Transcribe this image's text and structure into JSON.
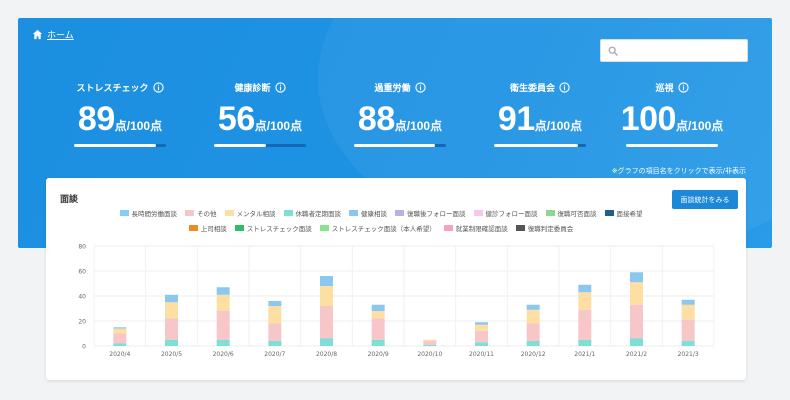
{
  "breadcrumb": {
    "home": "ホーム"
  },
  "search": {
    "placeholder": ""
  },
  "kpis": [
    {
      "label": "ストレスチェック",
      "value": "89",
      "unit": "点/100点",
      "progress": 0.89
    },
    {
      "label": "健康診断",
      "value": "56",
      "unit": "点/100点",
      "progress": 0.56
    },
    {
      "label": "過重労働",
      "value": "88",
      "unit": "点/100点",
      "progress": 0.88
    },
    {
      "label": "衛生委員会",
      "value": "91",
      "unit": "点/100点",
      "progress": 0.91
    },
    {
      "label": "巡視",
      "value": "100",
      "unit": "点/100点",
      "progress": 1.0
    }
  ],
  "note": "※グラフの項目名をクリックで表示/非表示",
  "card": {
    "title": "面談",
    "button": "面談統計をみる"
  },
  "chart_data": {
    "type": "bar",
    "stacked": true,
    "categories": [
      "2020/4",
      "2020/5",
      "2020/6",
      "2020/7",
      "2020/8",
      "2020/9",
      "2020/10",
      "2020/11",
      "2020/12",
      "2021/1",
      "2021/2",
      "2021/3"
    ],
    "ylim": [
      0,
      80
    ],
    "yticks": [
      0,
      20,
      40,
      60,
      80
    ],
    "grid": true,
    "legend_position": "top",
    "series": [
      {
        "name": "就業制限確認面談",
        "color": "#f4a3bd",
        "values": [
          0,
          0,
          0,
          0,
          0,
          0,
          0,
          0,
          0,
          0,
          0,
          0
        ]
      },
      {
        "name": "面接希望",
        "color": "#1f5f8b",
        "values": [
          0,
          0,
          0,
          0,
          0,
          0,
          0,
          0,
          0,
          0,
          0,
          0
        ]
      },
      {
        "name": "上司相談",
        "color": "#f08a24",
        "values": [
          0,
          0,
          0,
          0,
          0,
          0,
          0,
          0,
          0,
          0,
          0,
          0
        ]
      },
      {
        "name": "ストレスチェック面談",
        "color": "#2bbf6a",
        "values": [
          0,
          0,
          0,
          0,
          0,
          0,
          0,
          0,
          0,
          0,
          0,
          0
        ]
      },
      {
        "name": "ストレスチェック面談（本人希望）",
        "color": "#86e58c",
        "values": [
          0,
          0,
          0,
          0,
          0,
          0,
          0,
          0,
          0,
          0,
          0,
          0
        ]
      },
      {
        "name": "復職判定委員会",
        "color": "#555555",
        "values": [
          0,
          0,
          0,
          0,
          0,
          0,
          0,
          0,
          0,
          0,
          0,
          0
        ]
      },
      {
        "name": "長時間労働面談",
        "color": "#7fd0f2",
        "values": [
          0,
          0,
          0,
          0,
          0,
          0,
          0,
          0,
          0,
          0,
          0,
          0
        ]
      },
      {
        "name": "健診フォロー面談",
        "color": "#f7c6ee",
        "values": [
          0,
          0,
          0,
          0,
          0,
          0,
          0,
          0,
          0,
          0,
          0,
          0
        ]
      },
      {
        "name": "復職後フォロー面談",
        "color": "#b6b2e6",
        "values": [
          0,
          0,
          0,
          0,
          0,
          0,
          0,
          0,
          0,
          0,
          0,
          0
        ]
      },
      {
        "name": "復職可否面談",
        "color": "#8ed88e",
        "values": [
          0,
          0,
          0,
          0,
          0,
          0,
          0,
          0,
          0,
          0,
          0,
          0
        ]
      },
      {
        "name": "休職者定期面談",
        "color": "#7ddfd6",
        "values": [
          2,
          5,
          5,
          4,
          6,
          5,
          1,
          3,
          4,
          5,
          6,
          4
        ]
      },
      {
        "name": "その他",
        "color": "#f7c6c8",
        "values": [
          8,
          17,
          23,
          14,
          26,
          17,
          3,
          9,
          14,
          24,
          27,
          17
        ]
      },
      {
        "name": "メンタル相談",
        "color": "#fddea3",
        "values": [
          4,
          13,
          13,
          14,
          16,
          6,
          1,
          5,
          11,
          14,
          18,
          12
        ]
      },
      {
        "name": "健康相談",
        "color": "#8cc7ef",
        "values": [
          1,
          6,
          6,
          4,
          8,
          5,
          0,
          2,
          4,
          6,
          8,
          4
        ]
      }
    ]
  },
  "legend_order": [
    [
      "長時間労働面談",
      "#7fd0f2"
    ],
    [
      "その他",
      "#f7c6c8"
    ],
    [
      "メンタル相談",
      "#fddea3"
    ],
    [
      "休職者定期面談",
      "#7ddfd6"
    ],
    [
      "健康相談",
      "#8cc7ef"
    ],
    [
      "復職後フォロー面談",
      "#b6b2e6"
    ],
    [
      "健診フォロー面談",
      "#f7c6ee"
    ],
    [
      "復職可否面談",
      "#8ed88e"
    ],
    [
      "面接希望",
      "#1f5f8b"
    ],
    [
      "上司相談",
      "#f08a24"
    ],
    [
      "ストレスチェック面談",
      "#2bbf6a"
    ],
    [
      "ストレスチェック面談（本人希望）",
      "#86e58c"
    ],
    [
      "就業制限確認面談",
      "#f4a3bd"
    ],
    [
      "復職判定委員会",
      "#555555"
    ]
  ]
}
